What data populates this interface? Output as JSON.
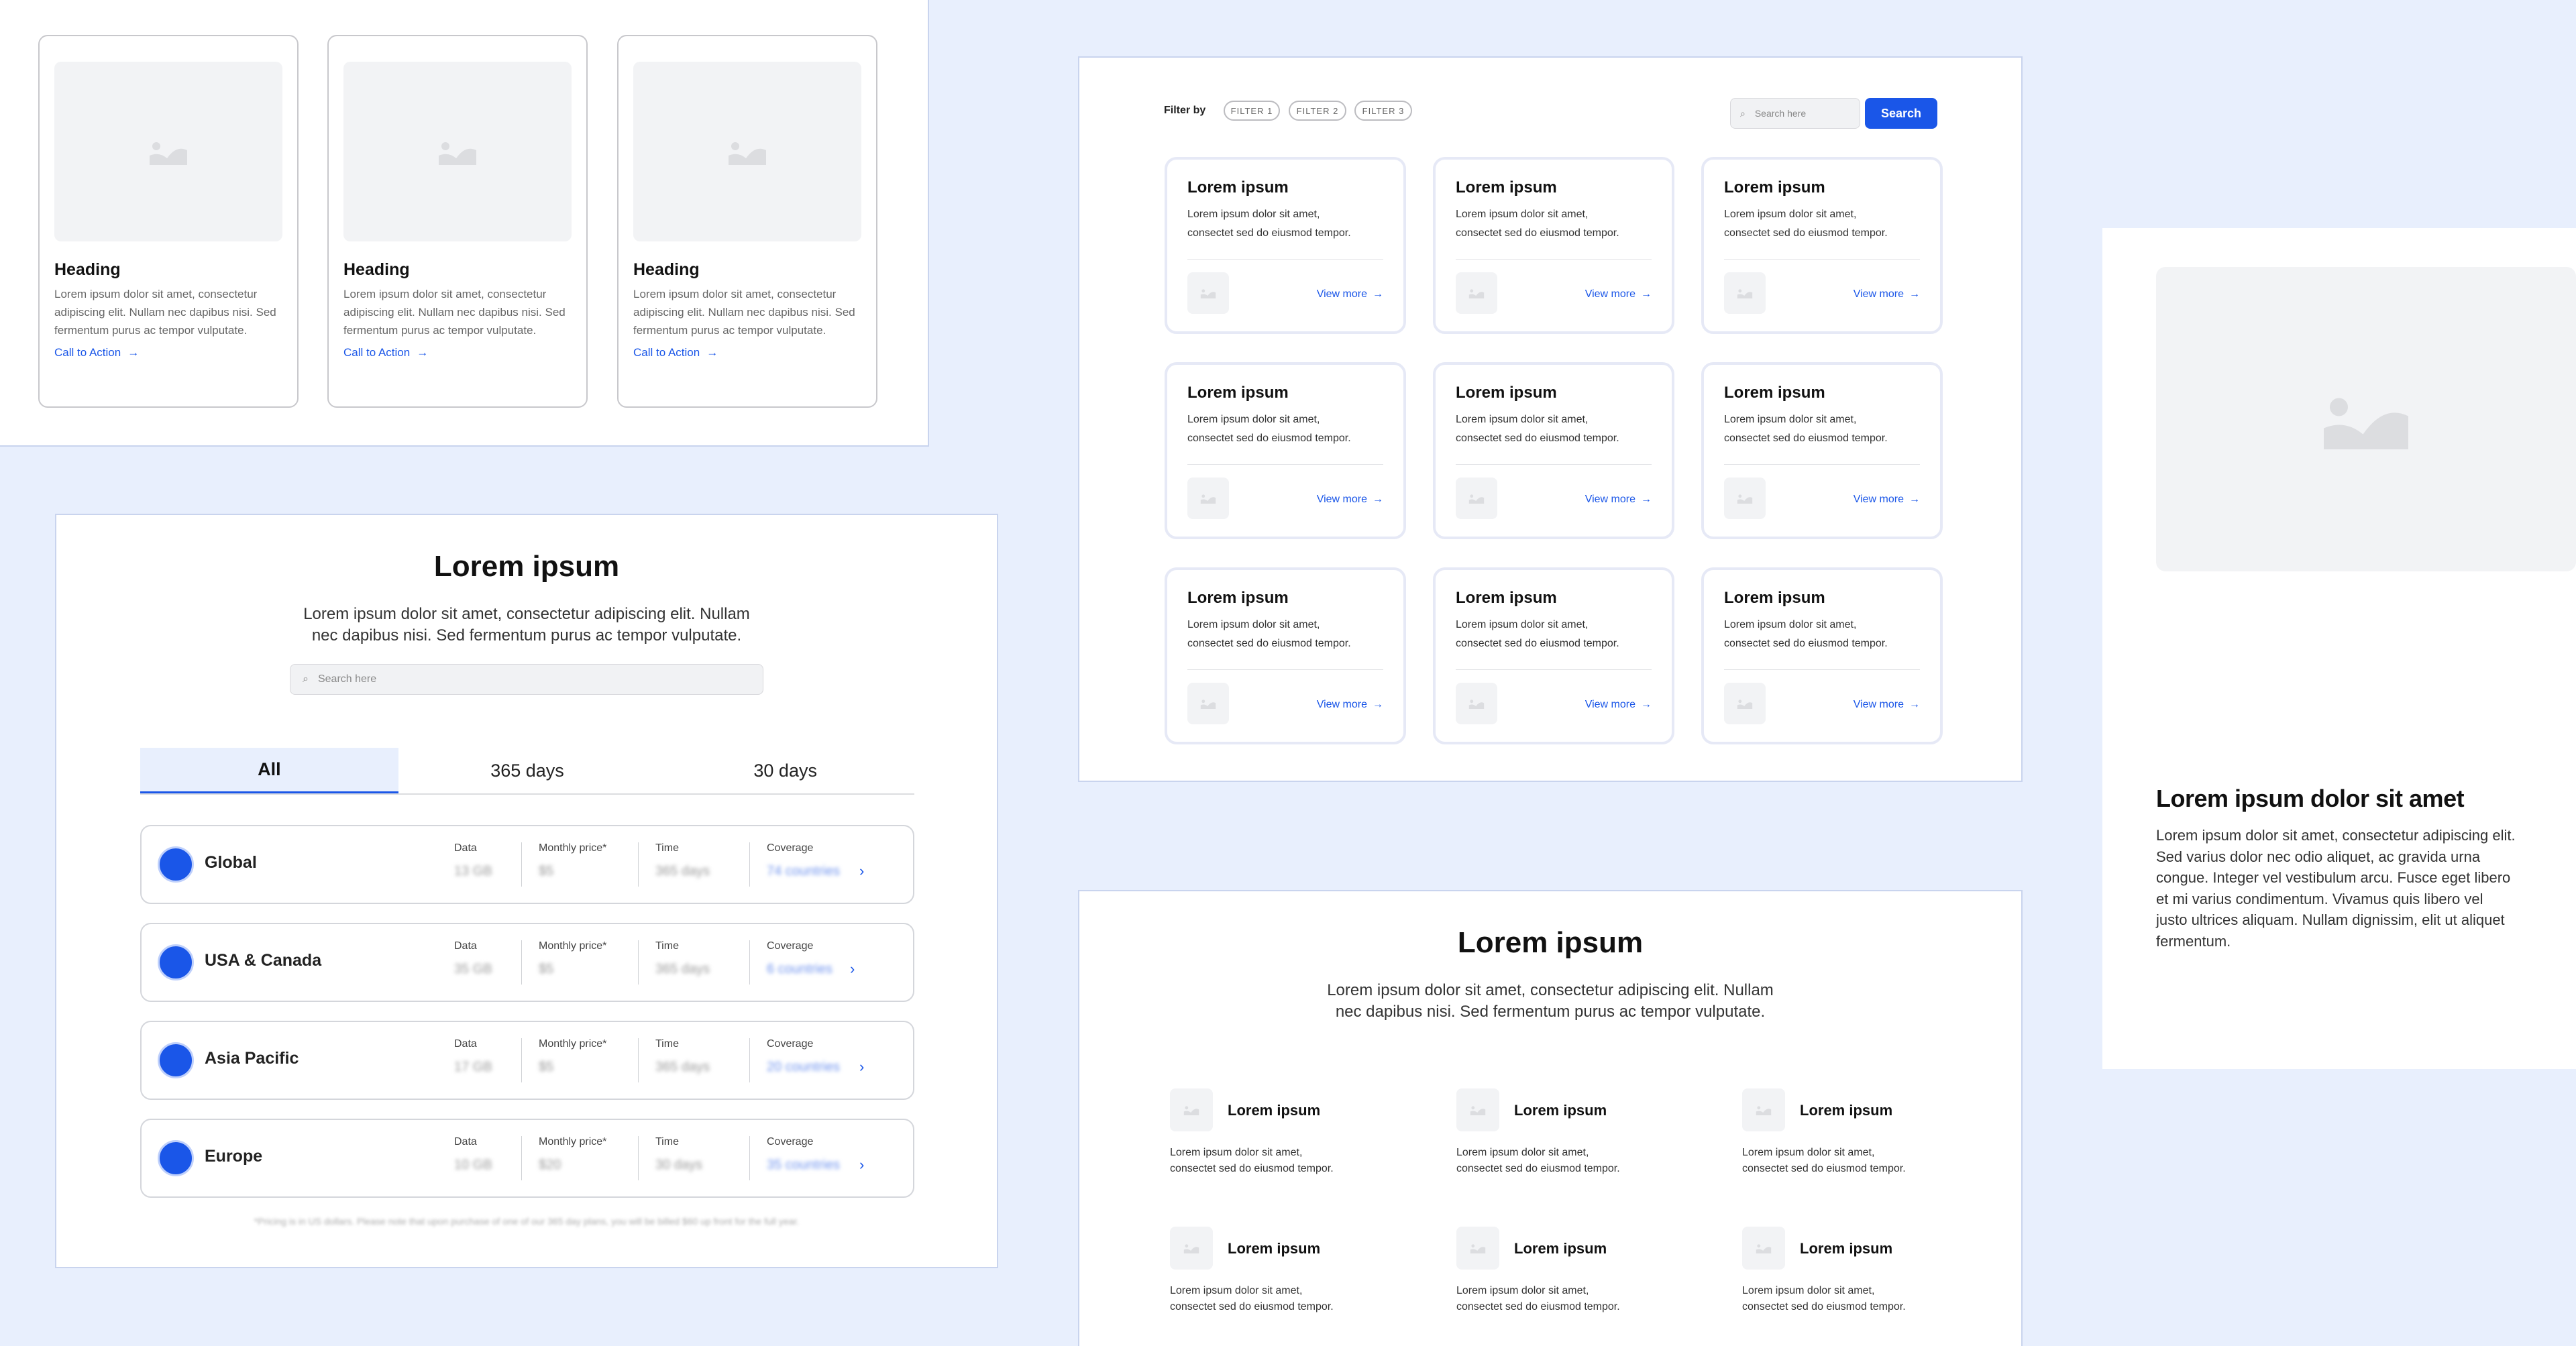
{
  "cards_panel": {
    "cards": [
      {
        "heading": "Heading",
        "body": "Lorem ipsum dolor sit amet, consectetur adipiscing elit. Nullam nec dapibus nisi. Sed fermentum purus ac tempor vulputate.",
        "cta": "Call to Action"
      },
      {
        "heading": "Heading",
        "body": "Lorem ipsum dolor sit amet, consectetur adipiscing elit. Nullam nec dapibus nisi. Sed fermentum purus ac tempor vulputate.",
        "cta": "Call to Action"
      },
      {
        "heading": "Heading",
        "body": "Lorem ipsum dolor sit amet, consectetur adipiscing elit. Nullam nec dapibus nisi. Sed fermentum purus ac tempor vulputate.",
        "cta": "Call to Action"
      }
    ]
  },
  "plans_panel": {
    "title": "Lorem ipsum",
    "subtitle_line1": "Lorem ipsum dolor sit amet, consectetur adipiscing elit. Nullam",
    "subtitle_line2": "nec dapibus nisi. Sed fermentum purus ac tempor vulputate.",
    "search_placeholder": "Search here",
    "tabs": [
      "All",
      "365 days",
      "30 days"
    ],
    "active_tab": "All",
    "column_labels": {
      "data": "Data",
      "price": "Monthly price*",
      "time": "Time",
      "coverage": "Coverage"
    },
    "regions": [
      {
        "name": "Global",
        "data": "13 GB",
        "price": "$5",
        "time": "365 days",
        "coverage": "74 countries"
      },
      {
        "name": "USA & Canada",
        "data": "35 GB",
        "price": "$5",
        "time": "365 days",
        "coverage": "6 countries"
      },
      {
        "name": "Asia Pacific",
        "data": "17 GB",
        "price": "$5",
        "time": "365 days",
        "coverage": "20 countries"
      },
      {
        "name": "Europe",
        "data": "10 GB",
        "price": "$20",
        "time": "30 days",
        "coverage": "35 countries"
      }
    ],
    "footnote": "*Pricing is in US dollars. Please note that upon purchase of one of our 365 day plans, you will be billed $60 up front for the full year."
  },
  "grid_panel": {
    "filter_label": "Filter by",
    "filters": [
      "FILTER 1",
      "FILTER 2",
      "FILTER 3"
    ],
    "search_placeholder": "Search here",
    "search_button": "Search",
    "card_title": "Lorem ipsum",
    "card_body_line1": "Lorem ipsum dolor sit amet,",
    "card_body_line2": "consectet sed do eiusmod tempor.",
    "view_more": "View more",
    "card_count": 9
  },
  "features_panel": {
    "title": "Lorem ipsum",
    "subtitle_line1": "Lorem ipsum dolor sit amet, consectetur adipiscing elit. Nullam",
    "subtitle_line2": "nec dapibus nisi. Sed fermentum purus ac tempor vulputate.",
    "item_title": "Lorem ipsum",
    "item_body_line1": "Lorem ipsum dolor sit amet,",
    "item_body_line2": "consectet sed do eiusmod tempor.",
    "item_count": 6
  },
  "hero_panel": {
    "title": "Lorem ipsum dolor sit amet",
    "body": "Lorem ipsum dolor sit amet, consectetur adipiscing elit. Sed varius dolor nec odio aliquet, ac gravida urna congue. Integer vel vestibulum arcu. Fusce eget libero et mi varius condimentum. Vivamus quis libero vel justo ultrices aliquam. Nullam dignissim, elit ut aliquet fermentum."
  },
  "colors": {
    "accent": "#1a56e8",
    "background": "#e8effd",
    "placeholder": "#f2f3f5"
  }
}
